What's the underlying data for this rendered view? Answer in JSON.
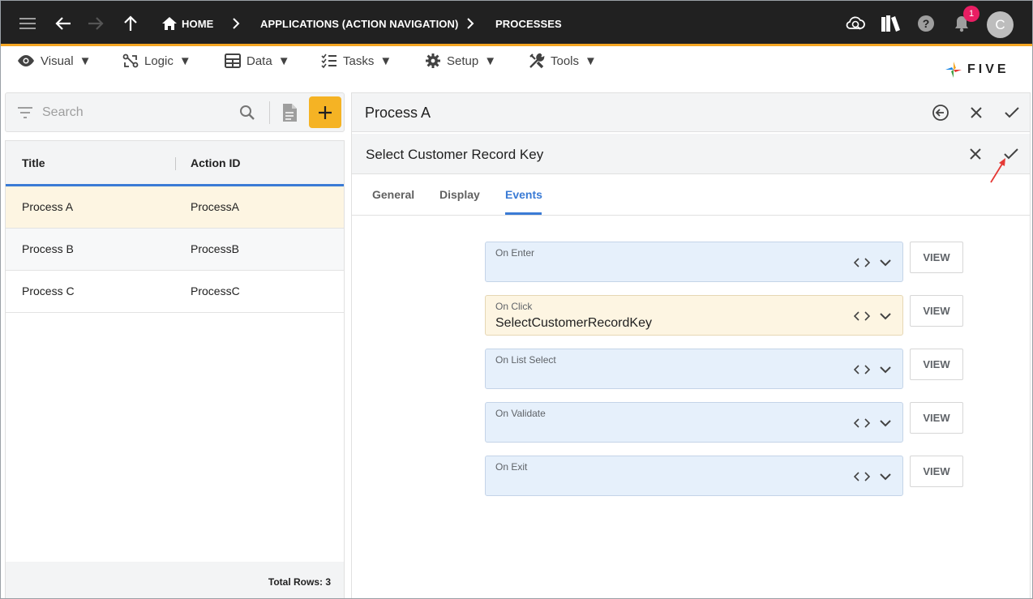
{
  "topbar": {
    "breadcrumbs": [
      {
        "label": "HOME"
      },
      {
        "label": "APPLICATIONS (ACTION NAVIGATION)"
      },
      {
        "label": "PROCESSES"
      }
    ],
    "notification_count": "1",
    "avatar_initial": "C"
  },
  "menubar": {
    "items": [
      {
        "label": "Visual",
        "icon": "eye-icon"
      },
      {
        "label": "Logic",
        "icon": "logic-icon"
      },
      {
        "label": "Data",
        "icon": "table-icon"
      },
      {
        "label": "Tasks",
        "icon": "tasks-icon"
      },
      {
        "label": "Setup",
        "icon": "gear-icon"
      },
      {
        "label": "Tools",
        "icon": "tools-icon"
      }
    ],
    "logo_text": "FIVE"
  },
  "list": {
    "search_placeholder": "Search",
    "columns": [
      "Title",
      "Action ID"
    ],
    "rows": [
      {
        "title": "Process A",
        "action_id": "ProcessA"
      },
      {
        "title": "Process B",
        "action_id": "ProcessB"
      },
      {
        "title": "Process C",
        "action_id": "ProcessC"
      }
    ],
    "footer": "Total Rows: 3"
  },
  "detail": {
    "record_title": "Process A",
    "sub_title": "Select Customer Record Key",
    "tabs": [
      {
        "label": "General"
      },
      {
        "label": "Display"
      },
      {
        "label": "Events"
      }
    ],
    "active_tab": "Events",
    "events": [
      {
        "label": "On Enter",
        "value": "",
        "button": "VIEW"
      },
      {
        "label": "On Click",
        "value": "SelectCustomerRecordKey",
        "button": "VIEW"
      },
      {
        "label": "On List Select",
        "value": "",
        "button": "VIEW"
      },
      {
        "label": "On Validate",
        "value": "",
        "button": "VIEW"
      },
      {
        "label": "On Exit",
        "value": "",
        "button": "VIEW"
      }
    ]
  },
  "colors": {
    "topbar_bg": "#212121",
    "accent_orange": "#f5a623",
    "add_button": "#f5b324",
    "active_blue": "#3a7bd5",
    "selected_row": "#fdf5e2",
    "badge": "#e91e63"
  }
}
